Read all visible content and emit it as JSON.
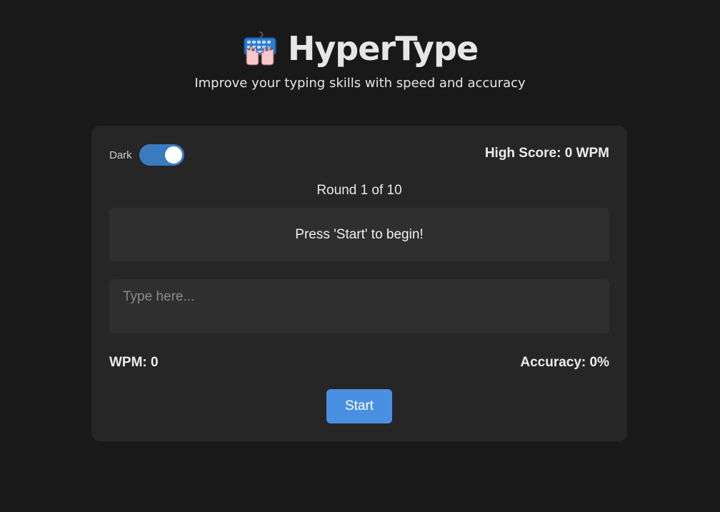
{
  "app": {
    "title": "HyperType",
    "subtitle": "Improve your typing skills with speed and accuracy",
    "logo_icon": "keyboard-hands-icon"
  },
  "settings": {
    "theme_label": "Dark",
    "theme_toggle_on": true
  },
  "stats": {
    "high_score": "High Score: 0 WPM",
    "round": "Round 1 of 10",
    "wpm": "WPM: 0",
    "accuracy": "Accuracy: 0%"
  },
  "prompt": {
    "text": "Press 'Start' to begin!"
  },
  "input": {
    "value": "",
    "placeholder": "Type here..."
  },
  "actions": {
    "start_label": "Start"
  },
  "colors": {
    "background": "#191919",
    "card": "#262626",
    "accent": "#4a90e2",
    "toggle": "#3a7bbf"
  }
}
